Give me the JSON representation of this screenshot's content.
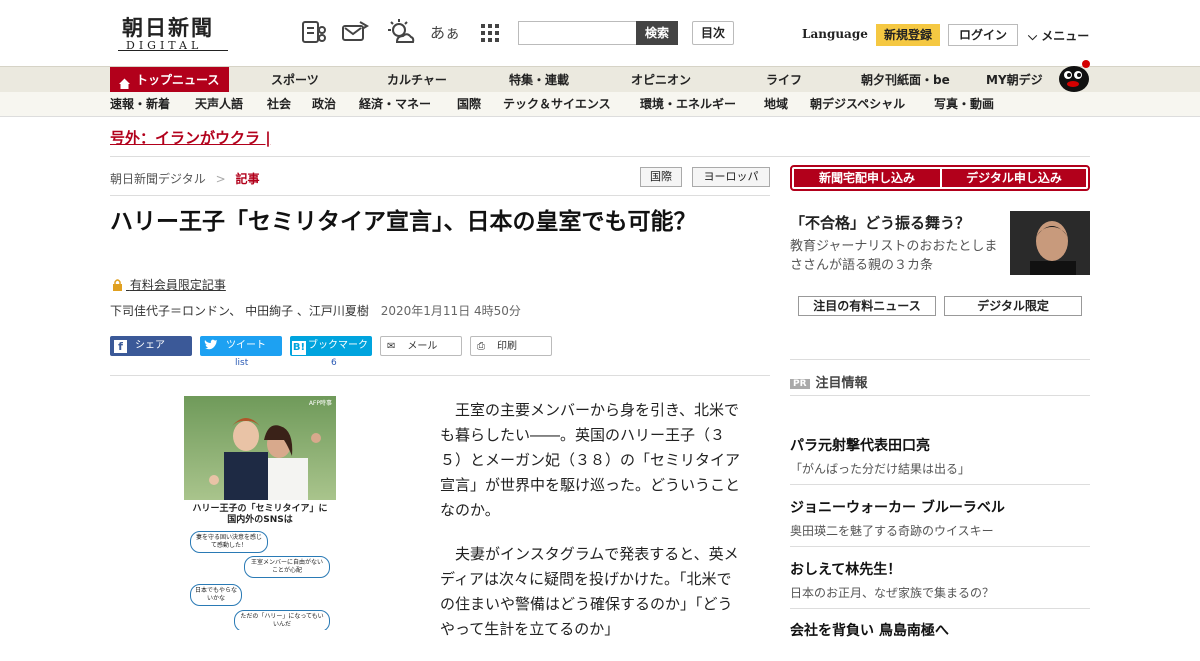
{
  "header": {
    "logo_main": "朝日新聞",
    "logo_sub": "DIGITAL",
    "search_button": "検索",
    "contents_button": "目次",
    "language": "Language",
    "register": "新規登録",
    "login": "ログイン",
    "menu": "メニュー",
    "font_size_icon_text": "あぁ"
  },
  "nav_primary": [
    "トップニュース",
    "スポーツ",
    "カルチャー",
    "特集・連載",
    "オピニオン",
    "ライフ",
    "朝夕刊紙面・be",
    "MY朝デジ"
  ],
  "nav_secondary": [
    "速報・新着",
    "天声人語",
    "社会",
    "政治",
    "経済・マネー",
    "国際",
    "テック＆サイエンス",
    "環境・エネルギー",
    "地域",
    "朝デジスペシャル",
    "写真・動画"
  ],
  "breaking": "号外：イランがウクラ",
  "breadcrumb": {
    "home": "朝日新聞デジタル",
    "separator": ">",
    "current": "記事"
  },
  "tags": [
    "国際",
    "ヨーロッパ"
  ],
  "article": {
    "title": "ハリー王子「セミリタイア宣言」、日本の皇室でも可能？",
    "paid_label": "有料会員限定記事",
    "authors": "下司佳代子＝ロンドン、 中田絢子 、江戸川夏樹",
    "date": "2020年1月11日 4時50分",
    "body": [
      "王室の主要メンバーから身を引き、北米でも暮らしたい――。英国のハリー王子（３５）とメーガン妃（３８）の「セミリタイア宣言」が世界中を駆け巡った。どういうことなのか。",
      "夫妻がインスタグラムで発表すると、英メディアは次々に疑問を投げかけた。「北米での住まいや警備はどう確保するのか」「どうやって生計を立てるのか」"
    ]
  },
  "share": {
    "facebook": "シェア",
    "twitter": "ツイート",
    "twitter_count": "list",
    "hatena": "ブックマーク",
    "hatena_count": "6",
    "mail": "メール",
    "print": "印刷"
  },
  "photo": {
    "credit": "AFP時事",
    "caption": "ハリー王子の「セミリタイア」に国内外のSNSは",
    "bubbles": [
      "妻を守る固い決意を感じて感動した！",
      "王室メンバーに自由がないことが心配",
      "日本でもやらないかな",
      "ただの「ハリー」になってもいいんだ"
    ]
  },
  "sidebar": {
    "subscribe_paper": "新聞宅配申し込み",
    "subscribe_digital": "デジタル申し込み",
    "promo_title": "「不合格」どう振る舞う？",
    "promo_desc": "教育ジャーナリストのおおたとしまささんが語る親の３カ条",
    "tab_paid": "注目の有料ニュース",
    "tab_digital": "デジタル限定",
    "pr_badge": "PR",
    "pr_title": "注目情報",
    "items": [
      {
        "title": "パラ元射撃代表田口亮",
        "desc": "「がんばった分だけ結果は出る」"
      },
      {
        "title": "ジョニーウォーカー ブルーラベル",
        "desc": "奥田瑛二を魅了する奇跡のウイスキー"
      },
      {
        "title": "おしえて林先生！",
        "desc": "日本のお正月、なぜ家族で集まるの？"
      },
      {
        "title": "会社を背負い 鳥島南極へ",
        "desc": ""
      }
    ]
  },
  "colors": {
    "brand_red": "#b2001b",
    "accent_yellow": "#f5c842",
    "facebook": "#3b5998",
    "twitter": "#1da1f2",
    "hatena": "#00a4de"
  }
}
